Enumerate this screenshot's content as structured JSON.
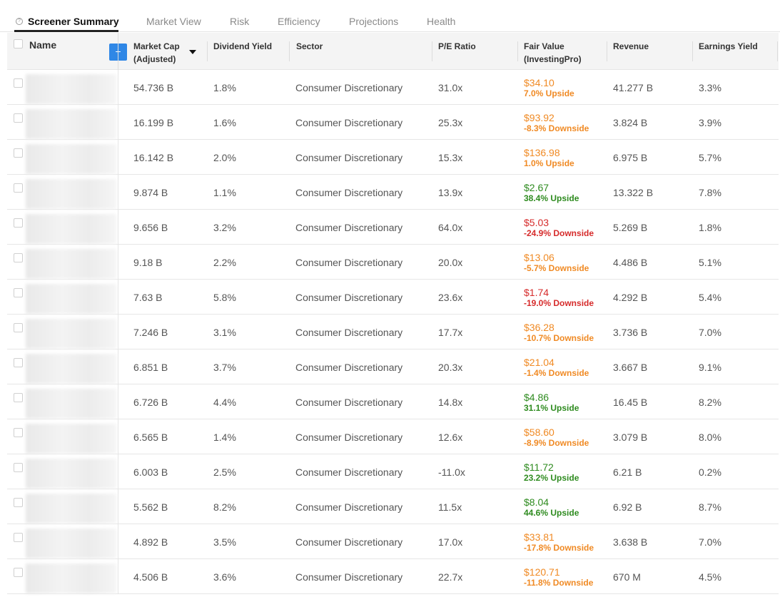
{
  "tabs": [
    {
      "label": "Screener Summary"
    },
    {
      "label": "Market View"
    },
    {
      "label": "Risk"
    },
    {
      "label": "Efficiency"
    },
    {
      "label": "Projections"
    },
    {
      "label": "Health"
    }
  ],
  "columns": {
    "name": "Name",
    "add": "+",
    "market_cap_line1": "Market Cap",
    "market_cap_line2": "(Adjusted)",
    "dividend_yield": "Dividend Yield",
    "sector": "Sector",
    "pe_ratio": "P/E Ratio",
    "fair_value_line1": "Fair Value",
    "fair_value_line2": "(InvestingPro)",
    "revenue": "Revenue",
    "earnings_yield": "Earnings Yield"
  },
  "colors": {
    "upside_green": "#2e8b1f",
    "neutral_orange": "#f08a24",
    "downside_red": "#d62b2b",
    "accent_blue": "#2f87e6"
  },
  "rows": [
    {
      "market_cap": "54.736 B",
      "dividend_yield": "1.8%",
      "sector": "Consumer Discretionary",
      "pe_ratio": "31.0x",
      "fair_value": "$34.10",
      "fair_value_change": "7.0% Upside",
      "fair_value_color": "#f08a24",
      "revenue": "41.277 B",
      "earnings_yield": "3.3%"
    },
    {
      "market_cap": "16.199 B",
      "dividend_yield": "1.6%",
      "sector": "Consumer Discretionary",
      "pe_ratio": "25.3x",
      "fair_value": "$93.92",
      "fair_value_change": "-8.3% Downside",
      "fair_value_color": "#f08a24",
      "revenue": "3.824 B",
      "earnings_yield": "3.9%"
    },
    {
      "market_cap": "16.142 B",
      "dividend_yield": "2.0%",
      "sector": "Consumer Discretionary",
      "pe_ratio": "15.3x",
      "fair_value": "$136.98",
      "fair_value_change": "1.0% Upside",
      "fair_value_color": "#f08a24",
      "revenue": "6.975 B",
      "earnings_yield": "5.7%"
    },
    {
      "market_cap": "9.874 B",
      "dividend_yield": "1.1%",
      "sector": "Consumer Discretionary",
      "pe_ratio": "13.9x",
      "fair_value": "$2.67",
      "fair_value_change": "38.4% Upside",
      "fair_value_color": "#2e8b1f",
      "revenue": "13.322 B",
      "earnings_yield": "7.8%"
    },
    {
      "market_cap": "9.656 B",
      "dividend_yield": "3.2%",
      "sector": "Consumer Discretionary",
      "pe_ratio": "64.0x",
      "fair_value": "$5.03",
      "fair_value_change": "-24.9% Downside",
      "fair_value_color": "#d62b2b",
      "revenue": "5.269 B",
      "earnings_yield": "1.8%"
    },
    {
      "market_cap": "9.18 B",
      "dividend_yield": "2.2%",
      "sector": "Consumer Discretionary",
      "pe_ratio": "20.0x",
      "fair_value": "$13.06",
      "fair_value_change": "-5.7% Downside",
      "fair_value_color": "#f08a24",
      "revenue": "4.486 B",
      "earnings_yield": "5.1%"
    },
    {
      "market_cap": "7.63 B",
      "dividend_yield": "5.8%",
      "sector": "Consumer Discretionary",
      "pe_ratio": "23.6x",
      "fair_value": "$1.74",
      "fair_value_change": "-19.0% Downside",
      "fair_value_color": "#d62b2b",
      "revenue": "4.292 B",
      "earnings_yield": "5.4%"
    },
    {
      "market_cap": "7.246 B",
      "dividend_yield": "3.1%",
      "sector": "Consumer Discretionary",
      "pe_ratio": "17.7x",
      "fair_value": "$36.28",
      "fair_value_change": "-10.7% Downside",
      "fair_value_color": "#f08a24",
      "revenue": "3.736 B",
      "earnings_yield": "7.0%"
    },
    {
      "market_cap": "6.851 B",
      "dividend_yield": "3.7%",
      "sector": "Consumer Discretionary",
      "pe_ratio": "20.3x",
      "fair_value": "$21.04",
      "fair_value_change": "-1.4% Downside",
      "fair_value_color": "#f08a24",
      "revenue": "3.667 B",
      "earnings_yield": "9.1%"
    },
    {
      "market_cap": "6.726 B",
      "dividend_yield": "4.4%",
      "sector": "Consumer Discretionary",
      "pe_ratio": "14.8x",
      "fair_value": "$4.86",
      "fair_value_change": "31.1% Upside",
      "fair_value_color": "#2e8b1f",
      "revenue": "16.45 B",
      "earnings_yield": "8.2%"
    },
    {
      "market_cap": "6.565 B",
      "dividend_yield": "1.4%",
      "sector": "Consumer Discretionary",
      "pe_ratio": "12.6x",
      "fair_value": "$58.60",
      "fair_value_change": "-8.9% Downside",
      "fair_value_color": "#f08a24",
      "revenue": "3.079 B",
      "earnings_yield": "8.0%"
    },
    {
      "market_cap": "6.003 B",
      "dividend_yield": "2.5%",
      "sector": "Consumer Discretionary",
      "pe_ratio": "-11.0x",
      "fair_value": "$11.72",
      "fair_value_change": "23.2% Upside",
      "fair_value_color": "#2e8b1f",
      "revenue": "6.21 B",
      "earnings_yield": "0.2%"
    },
    {
      "market_cap": "5.562 B",
      "dividend_yield": "8.2%",
      "sector": "Consumer Discretionary",
      "pe_ratio": "11.5x",
      "fair_value": "$8.04",
      "fair_value_change": "44.6% Upside",
      "fair_value_color": "#2e8b1f",
      "revenue": "6.92 B",
      "earnings_yield": "8.7%"
    },
    {
      "market_cap": "4.892 B",
      "dividend_yield": "3.5%",
      "sector": "Consumer Discretionary",
      "pe_ratio": "17.0x",
      "fair_value": "$33.81",
      "fair_value_change": "-17.8% Downside",
      "fair_value_color": "#f08a24",
      "revenue": "3.638 B",
      "earnings_yield": "7.0%"
    },
    {
      "market_cap": "4.506 B",
      "dividend_yield": "3.6%",
      "sector": "Consumer Discretionary",
      "pe_ratio": "22.7x",
      "fair_value": "$120.71",
      "fair_value_change": "-11.8% Downside",
      "fair_value_color": "#f08a24",
      "revenue": "670 M",
      "earnings_yield": "4.5%"
    }
  ]
}
